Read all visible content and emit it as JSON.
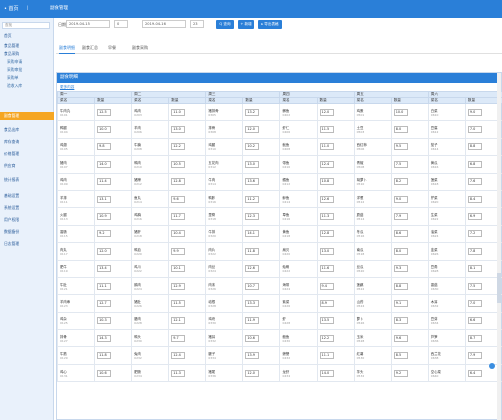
{
  "topbar": {
    "logo": "• 首页",
    "user": "|",
    "nav": "副食管理"
  },
  "sidebar": {
    "search_placeholder": "查找",
    "items": [
      {
        "label": "首页",
        "sub": false
      },
      {
        "label": "食品管理",
        "sub": false
      },
      {
        "label": "食品采购",
        "sub": false
      },
      {
        "label": "采购申请",
        "sub": true
      },
      {
        "label": "采购审批",
        "sub": true
      },
      {
        "label": "采购单",
        "sub": true
      },
      {
        "label": "验收入库",
        "sub": true
      },
      {
        "label": "副食管理",
        "sub": false,
        "active": true
      },
      {
        "label": "食品出库",
        "sub": false
      },
      {
        "label": "库存查询",
        "sub": false
      },
      {
        "label": "价格管理",
        "sub": false
      },
      {
        "label": "供应商",
        "sub": false
      },
      {
        "label": "统计报表",
        "sub": false
      },
      {
        "label": "基础设置",
        "sub": false
      },
      {
        "label": "系统设置",
        "sub": false
      },
      {
        "label": "用户权限",
        "sub": false
      },
      {
        "label": "数据备份",
        "sub": false
      },
      {
        "label": "日志管理",
        "sub": false
      }
    ]
  },
  "filter": {
    "date_label": "日期",
    "date_from": "2019-04-15",
    "time_from": "0",
    "date_to": "2019-04-16",
    "time_to": "23",
    "search_btn": "Q 查询",
    "add_btn": "+ 新增",
    "export_btn": "▸ 导出表格"
  },
  "tabs": [
    "副食明细",
    "副食汇总",
    "早餐",
    "副食采购"
  ],
  "panel": {
    "title": "副食明细",
    "subtitle": "更多内容"
  },
  "table": {
    "groups": [
      "周一",
      "周二",
      "周三",
      "周四",
      "周五",
      "周六"
    ],
    "subheaders": [
      "菜名",
      "数量"
    ],
    "rows": [
      {
        "cells": [
          [
            "牛肉丸",
            "0101"
          ],
          [
            "12.5"
          ],
          [
            "鸡肉",
            "0203"
          ],
          [
            "11.0"
          ],
          [
            "猪排骨",
            "0305"
          ],
          [
            "13.2"
          ],
          [
            "鲫鱼",
            "0402"
          ],
          [
            "12.0"
          ],
          [
            "鸡蛋",
            "0501"
          ],
          [
            "10.0"
          ],
          [
            "白菜",
            "0610"
          ],
          [
            "9.0"
          ]
        ]
      },
      {
        "cells": [
          [
            "鸭腿",
            "0104"
          ],
          [
            "10.0"
          ],
          [
            "羊肉",
            "0206"
          ],
          [
            "13.0"
          ],
          [
            "排骨",
            "0308"
          ],
          [
            "12.0"
          ],
          [
            "虾仁",
            "0406"
          ],
          [
            "11.5"
          ],
          [
            "土豆",
            "0503"
          ],
          [
            "8.0"
          ],
          [
            "豆腐",
            "0612"
          ],
          [
            "7.0"
          ]
        ]
      },
      {
        "cells": [
          [
            "鸡翅",
            "0105"
          ],
          [
            "9.8"
          ],
          [
            "牛腩",
            "0208"
          ],
          [
            "12.2"
          ],
          [
            "鸡腿",
            "0310"
          ],
          [
            "10.2"
          ],
          [
            "鱿鱼",
            "0408"
          ],
          [
            "11.0"
          ],
          [
            "西红柿",
            "0506"
          ],
          [
            "9.5"
          ],
          [
            "茄子",
            "0614"
          ],
          [
            "8.8"
          ]
        ]
      },
      {
        "cells": [
          [
            "猪肉",
            "0107"
          ],
          [
            "14.0"
          ],
          [
            "鸭肉",
            "0210"
          ],
          [
            "10.5"
          ],
          [
            "五花肉",
            "0312"
          ],
          [
            "13.0"
          ],
          [
            "带鱼",
            "0410"
          ],
          [
            "12.4"
          ],
          [
            "青椒",
            "0508"
          ],
          [
            "7.5"
          ],
          [
            "黄瓜",
            "0616"
          ],
          [
            "6.8"
          ]
        ]
      },
      {
        "cells": [
          [
            "鸡肉",
            "0109"
          ],
          [
            "11.4"
          ],
          [
            "猪蹄",
            "0212"
          ],
          [
            "12.8"
          ],
          [
            "牛肉",
            "0314"
          ],
          [
            "13.6"
          ],
          [
            "鳕鱼",
            "0412"
          ],
          [
            "10.8"
          ],
          [
            "胡萝卜",
            "0510"
          ],
          [
            "8.2"
          ],
          [
            "菠菜",
            "0618"
          ],
          [
            "7.6"
          ]
        ]
      },
      {
        "cells": [
          [
            "羊排",
            "0111"
          ],
          [
            "13.1"
          ],
          [
            "鱼丸",
            "0214"
          ],
          [
            "9.6"
          ],
          [
            "鸭胗",
            "0316"
          ],
          [
            "11.2"
          ],
          [
            "鲈鱼",
            "0414"
          ],
          [
            "12.6"
          ],
          [
            "洋葱",
            "0512"
          ],
          [
            "9.0"
          ],
          [
            "芹菜",
            "0620"
          ],
          [
            "8.4"
          ]
        ]
      },
      {
        "cells": [
          [
            "火腿",
            "0113"
          ],
          [
            "10.9"
          ],
          [
            "鸡胸",
            "0216"
          ],
          [
            "11.7"
          ],
          [
            "里脊",
            "0318"
          ],
          [
            "12.3"
          ],
          [
            "草鱼",
            "0416"
          ],
          [
            "11.3"
          ],
          [
            "蘑菇",
            "0514"
          ],
          [
            "7.9"
          ],
          [
            "生菜",
            "0622"
          ],
          [
            "6.9"
          ]
        ]
      },
      {
        "cells": [
          [
            "香肠",
            "0115"
          ],
          [
            "9.2"
          ],
          [
            "猪肝",
            "0218"
          ],
          [
            "10.4"
          ],
          [
            "牛排",
            "0320"
          ],
          [
            "14.1"
          ],
          [
            "黄鱼",
            "0418"
          ],
          [
            "12.8"
          ],
          [
            "冬瓜",
            "0516"
          ],
          [
            "8.6"
          ],
          [
            "油菜",
            "0624"
          ],
          [
            "7.2"
          ]
        ]
      },
      {
        "cells": [
          [
            "肉丸",
            "0117"
          ],
          [
            "12.0"
          ],
          [
            "鸭血",
            "0220"
          ],
          [
            "9.9"
          ],
          [
            "肉片",
            "0322"
          ],
          [
            "11.8"
          ],
          [
            "扇贝",
            "0420"
          ],
          [
            "13.0"
          ],
          [
            "南瓜",
            "0518"
          ],
          [
            "8.0"
          ],
          [
            "韭菜",
            "0626"
          ],
          [
            "7.8"
          ]
        ]
      },
      {
        "cells": [
          [
            "肥牛",
            "0119"
          ],
          [
            "13.4"
          ],
          [
            "鸡爪",
            "0222"
          ],
          [
            "10.1"
          ],
          [
            "肉丝",
            "0324"
          ],
          [
            "12.6"
          ],
          [
            "蛤蜊",
            "0422"
          ],
          [
            "11.6"
          ],
          [
            "丝瓜",
            "0520"
          ],
          [
            "9.3"
          ],
          [
            "豆角",
            "0628"
          ],
          [
            "8.1"
          ]
        ]
      },
      {
        "cells": [
          [
            "牛肚",
            "0121"
          ],
          [
            "11.1"
          ],
          [
            "鹅肉",
            "0224"
          ],
          [
            "12.9"
          ],
          [
            "肉末",
            "0326"
          ],
          [
            "10.7"
          ],
          [
            "海带",
            "0424"
          ],
          [
            "9.4"
          ],
          [
            "莲藕",
            "0522"
          ],
          [
            "8.8"
          ],
          [
            "香菇",
            "0630"
          ],
          [
            "7.5"
          ]
        ]
      },
      {
        "cells": [
          [
            "羊肉串",
            "0123"
          ],
          [
            "12.7"
          ],
          [
            "猪肚",
            "0226"
          ],
          [
            "11.5"
          ],
          [
            "培根",
            "0328"
          ],
          [
            "13.3"
          ],
          [
            "紫菜",
            "0426"
          ],
          [
            "8.9"
          ],
          [
            "山药",
            "0524"
          ],
          [
            "9.1"
          ],
          [
            "木耳",
            "0632"
          ],
          [
            "7.0"
          ]
        ]
      },
      {
        "cells": [
          [
            "鸡杂",
            "0125"
          ],
          [
            "10.3"
          ],
          [
            "腊肉",
            "0228"
          ],
          [
            "12.1"
          ],
          [
            "鸡块",
            "0330"
          ],
          [
            "11.9"
          ],
          [
            "虾",
            "0428"
          ],
          [
            "13.5"
          ],
          [
            "萝卜",
            "0526"
          ],
          [
            "8.3"
          ],
          [
            "豆芽",
            "0634"
          ],
          [
            "6.6"
          ]
        ]
      },
      {
        "cells": [
          [
            "排骨",
            "0127"
          ],
          [
            "14.3"
          ],
          [
            "鸭头",
            "0230"
          ],
          [
            "9.7"
          ],
          [
            "猪耳",
            "0332"
          ],
          [
            "10.6"
          ],
          [
            "鲍鱼",
            "0430"
          ],
          [
            "12.2"
          ],
          [
            "玉米",
            "0528"
          ],
          [
            "9.6"
          ],
          [
            "芦笋",
            "0636"
          ],
          [
            "8.7"
          ]
        ]
      },
      {
        "cells": [
          [
            "牛筋",
            "0129"
          ],
          [
            "11.8"
          ],
          [
            "兔肉",
            "0232"
          ],
          [
            "12.4"
          ],
          [
            "腱子",
            "0334"
          ],
          [
            "13.9"
          ],
          [
            "螃蟹",
            "0432"
          ],
          [
            "11.1"
          ],
          [
            "红薯",
            "0530"
          ],
          [
            "8.5"
          ],
          [
            "西兰花",
            "0638"
          ],
          [
            "7.9"
          ]
        ]
      },
      {
        "cells": [
          [
            "鸡心",
            "0131"
          ],
          [
            "10.6"
          ],
          [
            "肥肠",
            "0234"
          ],
          [
            "11.3"
          ],
          [
            "猪尾",
            "0336"
          ],
          [
            "12.0"
          ],
          [
            "龙虾",
            "0434"
          ],
          [
            "14.0"
          ],
          [
            "芋头",
            "0532"
          ],
          [
            "9.2"
          ],
          [
            "空心菜",
            "0640"
          ],
          [
            "6.4"
          ]
        ]
      }
    ]
  },
  "colors": {
    "brand": "#2a7fd8",
    "active_menu": "#f5a623"
  }
}
